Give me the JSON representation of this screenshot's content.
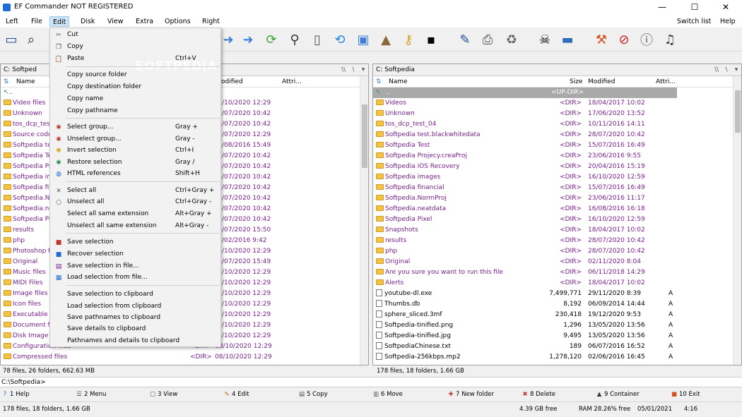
{
  "window": {
    "title": "EF Commander NOT REGISTERED",
    "min": "—",
    "max": "☐",
    "close": "✕"
  },
  "menubar": {
    "items": [
      "Left",
      "File",
      "Edit",
      "Disk",
      "View",
      "Extra",
      "Options",
      "Right"
    ],
    "right_items": [
      "Switch list",
      "Help"
    ]
  },
  "watermark": "SOFTPEDIA",
  "edit_menu": {
    "items": [
      {
        "label": "Cut",
        "shortcut": "",
        "icon": "scissors-icon",
        "glyph": "✂"
      },
      {
        "label": "Copy",
        "shortcut": "",
        "icon": "copy-icon",
        "glyph": "❐"
      },
      {
        "label": "Paste",
        "shortcut": "Ctrl+V",
        "icon": "paste-icon",
        "glyph": "📋"
      },
      {
        "label": "Copy source folder",
        "shortcut": "",
        "icon": "",
        "glyph": ""
      },
      {
        "label": "Copy destination folder",
        "shortcut": "",
        "icon": "",
        "glyph": ""
      },
      {
        "label": "Copy name",
        "shortcut": "",
        "icon": "",
        "glyph": ""
      },
      {
        "label": "Copy pathname",
        "shortcut": "",
        "icon": "",
        "glyph": ""
      },
      {
        "label": "Select group...",
        "shortcut": "Gray +",
        "icon": "plus-star-icon",
        "glyph": "✱"
      },
      {
        "label": "Unselect group...",
        "shortcut": "Gray -",
        "icon": "minus-star-icon",
        "glyph": "✱"
      },
      {
        "label": "Invert selection",
        "shortcut": "Ctrl+I",
        "icon": "invert-star-icon",
        "glyph": "✱"
      },
      {
        "label": "Restore selection",
        "shortcut": "Gray /",
        "icon": "restore-star-icon",
        "glyph": "✱"
      },
      {
        "label": "HTML references",
        "shortcut": "Shift+H",
        "icon": "globe-icon",
        "glyph": "◍"
      },
      {
        "label": "Select all",
        "shortcut": "Ctrl+Gray +",
        "icon": "select-all-icon",
        "glyph": "✕"
      },
      {
        "label": "Unselect all",
        "shortcut": "Ctrl+Gray -",
        "icon": "unselect-all-icon",
        "glyph": "○"
      },
      {
        "label": "Select all same extension",
        "shortcut": "Alt+Gray +",
        "icon": "",
        "glyph": ""
      },
      {
        "label": "Unselect all same extension",
        "shortcut": "Alt+Gray -",
        "icon": "",
        "glyph": ""
      },
      {
        "label": "Save selection",
        "shortcut": "",
        "icon": "save-selection-icon",
        "glyph": "■"
      },
      {
        "label": "Recover selection",
        "shortcut": "",
        "icon": "recover-selection-icon",
        "glyph": "■"
      },
      {
        "label": "Save selection in file...",
        "shortcut": "",
        "icon": "save-file-icon",
        "glyph": "▤"
      },
      {
        "label": "Load selection from file...",
        "shortcut": "",
        "icon": "load-file-icon",
        "glyph": "▦"
      },
      {
        "label": "Save selection to clipboard",
        "shortcut": "",
        "icon": "",
        "glyph": ""
      },
      {
        "label": "Load selection from clipboard",
        "shortcut": "",
        "icon": "",
        "glyph": ""
      },
      {
        "label": "Save pathnames to clipboard",
        "shortcut": "",
        "icon": "",
        "glyph": ""
      },
      {
        "label": "Save details to clipboard",
        "shortcut": "",
        "icon": "",
        "glyph": ""
      },
      {
        "label": "Pathnames and details to clipboard",
        "shortcut": "",
        "icon": "",
        "glyph": ""
      }
    ]
  },
  "left_panel": {
    "drive": "C:",
    "path_visible": "Softped",
    "columns": {
      "name": "Name",
      "modified": "odified",
      "attr": "Attri..."
    },
    "rows": [
      {
        "name": "..",
        "date": "",
        "up": true
      },
      {
        "name": "Video files",
        "date": "/10/2020 12:29"
      },
      {
        "name": "Unknown",
        "date": "/07/2020 10:42"
      },
      {
        "name": "tos_dcp_test",
        "date": "/07/2020 10:42"
      },
      {
        "name": "Source code",
        "date": "/07/2020 12:29"
      },
      {
        "name": "Softpedia tes",
        "date": "/08/2016 15:49"
      },
      {
        "name": "Softpedia Te",
        "date": "/07/2020 10:42"
      },
      {
        "name": "Softpedia Pr",
        "date": "/07/2020 10:42"
      },
      {
        "name": "Softpedia im",
        "date": "/07/2020 10:42"
      },
      {
        "name": "Softpedia fin",
        "date": "/07/2020 10:42"
      },
      {
        "name": "Softpedia.No",
        "date": "/07/2020 10:42"
      },
      {
        "name": "Softpedia.ne",
        "date": "/07/2020 10:42"
      },
      {
        "name": "Softpedia Pixe",
        "date": "/07/2020 10:42"
      },
      {
        "name": "results",
        "date": "/07/2020 15:50"
      },
      {
        "name": "php",
        "date": "/02/2016 9:42"
      },
      {
        "name": "Photoshop f",
        "date": "/10/2020 12:29"
      },
      {
        "name": "Original",
        "date": "/07/2020 15:49"
      },
      {
        "name": "Music files",
        "date": "/10/2020 12:29"
      },
      {
        "name": "MIDI Files",
        "date": "/10/2020 12:29"
      },
      {
        "name": "Image files",
        "date": "/10/2020 12:29"
      },
      {
        "name": "Icon files",
        "date": "/10/2020 12:29"
      },
      {
        "name": "Executable fi",
        "date": "/10/2020 12:29"
      },
      {
        "name": "Document fi",
        "date": "/10/2020 12:29"
      },
      {
        "name": "Disk Image f",
        "date": "/10/2020 12:29"
      },
      {
        "name": "Configuration files",
        "size": "<DIR>",
        "date": "08/10/2020 12:29"
      },
      {
        "name": "Compressed files",
        "size": "<DIR>",
        "date": "08/10/2020 12:29"
      }
    ],
    "status": "78 files, 26 folders, 662.63 MB"
  },
  "right_panel": {
    "drive": "C:",
    "path": "Softpedia",
    "columns": {
      "name": "Name",
      "size": "Size",
      "modified": "Modified",
      "attr": "Attri..."
    },
    "updir": "<UP-DIR>",
    "rows": [
      {
        "name": "Videos",
        "size": "<DIR>",
        "date": "18/04/2017 10:02",
        "attr": "",
        "type": "folder"
      },
      {
        "name": "Unknown",
        "size": "<DIR>",
        "date": "17/06/2020 13:52",
        "attr": "",
        "type": "folder"
      },
      {
        "name": "tos_dcp_test_04",
        "size": "<DIR>",
        "date": "10/11/2016 14:11",
        "attr": "",
        "type": "folder"
      },
      {
        "name": "Softpedia test.blackwhitedata",
        "size": "<DIR>",
        "date": "28/07/2020 10:42",
        "attr": "",
        "type": "folder"
      },
      {
        "name": "Softpedia Test",
        "size": "<DIR>",
        "date": "15/07/2016 16:49",
        "attr": "",
        "type": "folder"
      },
      {
        "name": "Softpedia Projecy.creaProj",
        "size": "<DIR>",
        "date": "23/06/2016 9:55",
        "attr": "",
        "type": "folder"
      },
      {
        "name": "Softpedia iOS Recovery",
        "size": "<DIR>",
        "date": "20/04/2016 15:19",
        "attr": "",
        "type": "folder"
      },
      {
        "name": "Softpedia images",
        "size": "<DIR>",
        "date": "16/10/2020 12:59",
        "attr": "",
        "type": "folder"
      },
      {
        "name": "Softpedia financial",
        "size": "<DIR>",
        "date": "15/07/2016 16:49",
        "attr": "",
        "type": "folder"
      },
      {
        "name": "Softpedia.NormProj",
        "size": "<DIR>",
        "date": "23/06/2016 11:17",
        "attr": "",
        "type": "folder"
      },
      {
        "name": "Softpedia.neatdata",
        "size": "<DIR>",
        "date": "16/08/2016 16:18",
        "attr": "",
        "type": "folder"
      },
      {
        "name": "Softpedia Pixel",
        "size": "<DIR>",
        "date": "16/10/2020 12:59",
        "attr": "",
        "type": "folder"
      },
      {
        "name": "Snapshots",
        "size": "<DIR>",
        "date": "18/04/2017 10:02",
        "attr": "",
        "type": "folder"
      },
      {
        "name": "results",
        "size": "<DIR>",
        "date": "28/07/2020 10:42",
        "attr": "",
        "type": "folder"
      },
      {
        "name": "php",
        "size": "<DIR>",
        "date": "28/07/2020 10:42",
        "attr": "",
        "type": "folder"
      },
      {
        "name": "Original",
        "size": "<DIR>",
        "date": "02/11/2020 8:04",
        "attr": "",
        "type": "folder"
      },
      {
        "name": "Are you sure you want to run this file",
        "size": "<DIR>",
        "date": "06/11/2018 14:29",
        "attr": "",
        "type": "folder"
      },
      {
        "name": "Alerts",
        "size": "<DIR>",
        "date": "18/04/2017 10:02",
        "attr": "",
        "type": "folder"
      },
      {
        "name": "youtube-dl.exe",
        "size": "7,499,771",
        "date": "29/11/2020 8:39",
        "attr": "A",
        "type": "file"
      },
      {
        "name": "Thumbs.db",
        "size": "8,192",
        "date": "06/09/2014 14:44",
        "attr": "A",
        "type": "file"
      },
      {
        "name": "sphere_sliced.3mf",
        "size": "230,418",
        "date": "19/12/2020 9:53",
        "attr": "A",
        "type": "file"
      },
      {
        "name": "Softpedia-tinified.png",
        "size": "1,296",
        "date": "13/05/2020 13:56",
        "attr": "A",
        "type": "file"
      },
      {
        "name": "Softpedia-tinified.jpg",
        "size": "9,495",
        "date": "13/05/2020 13:56",
        "attr": "A",
        "type": "file"
      },
      {
        "name": "SoftpediaChinese.txt",
        "size": "189",
        "date": "06/07/2016 16:52",
        "attr": "A",
        "type": "file"
      },
      {
        "name": "Softpedia-256kbps.mp2",
        "size": "1,278,120",
        "date": "02/06/2016 16:45",
        "attr": "A",
        "type": "file"
      }
    ],
    "status": "178 files, 18 folders, 1.66 GB"
  },
  "cmdline": "C:\\Softpedia>",
  "fkeys": [
    {
      "label": "1 Help",
      "icon": "help-icon",
      "glyph": "?"
    },
    {
      "label": "2 Menu",
      "icon": "menu-icon",
      "glyph": "☰"
    },
    {
      "label": "3 View",
      "icon": "view-icon",
      "glyph": "▢"
    },
    {
      "label": "4 Edit",
      "icon": "edit-icon",
      "glyph": "✎"
    },
    {
      "label": "5 Copy",
      "icon": "copy-fkey-icon",
      "glyph": "▤"
    },
    {
      "label": "6 Move",
      "icon": "move-icon",
      "glyph": "▥"
    },
    {
      "label": "7 New folder",
      "icon": "new-folder-icon",
      "glyph": "✚"
    },
    {
      "label": "8 Delete",
      "icon": "delete-icon",
      "glyph": "✖"
    },
    {
      "label": "9 Container",
      "icon": "container-icon",
      "glyph": "▲"
    },
    {
      "label": "10 Exit",
      "icon": "exit-icon",
      "glyph": "■"
    }
  ],
  "bottombar": {
    "status": "178 files, 18 folders, 1.66 GB",
    "free": "4.39 GB free",
    "ram": "RAM 28.26% free",
    "date": "05/01/2021",
    "time": "4:16"
  },
  "colors": {
    "folder_text": "#7a1f8e",
    "date_text": "#7a1f8e",
    "menu_highlight": "#cce4f7",
    "updir_bg": "#a9a9a9"
  }
}
